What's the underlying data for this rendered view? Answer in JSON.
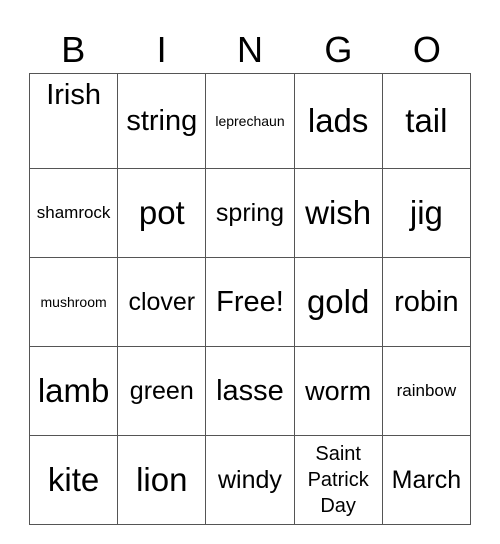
{
  "header": [
    "B",
    "I",
    "N",
    "G",
    "O"
  ],
  "rows": [
    [
      "Irish",
      "string",
      "leprechaun",
      "lads",
      "tail"
    ],
    [
      "shamrock",
      "pot",
      "spring",
      "wish",
      "jig"
    ],
    [
      "mushroom",
      "clover",
      "Free!",
      "gold",
      "robin"
    ],
    [
      "lamb",
      "green",
      "lasse",
      "worm",
      "rainbow"
    ],
    [
      "kite",
      "lion",
      "windy",
      "Saint Patrick Day",
      "March"
    ]
  ]
}
